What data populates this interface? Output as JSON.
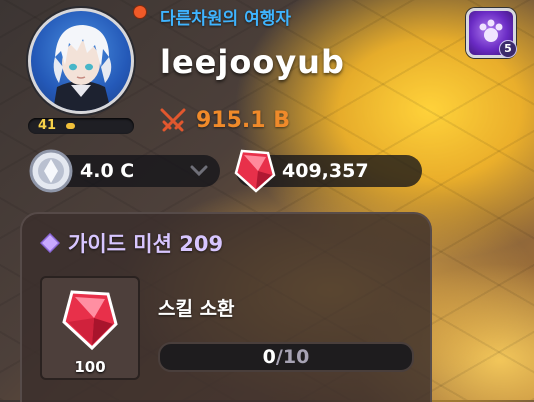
{
  "profile": {
    "subtitle": "다른차원의 여행자",
    "username": "leejooyub",
    "level": "41",
    "level_progress": 0.15,
    "combat_power": "915.1 B",
    "notification": true
  },
  "badge": {
    "count": "5",
    "icon": "purple-paw-emblem-icon"
  },
  "currencies": {
    "coin": {
      "value": "4.0 C",
      "icon": "silver-coin-icon"
    },
    "gem": {
      "value": "409,357",
      "icon": "red-gem-icon"
    }
  },
  "mission": {
    "title": "가이드 미션 209",
    "name": "스킬 소환",
    "reward_qty": "100",
    "reward_icon": "red-gem-icon",
    "progress_current": "0",
    "progress_separator": "/",
    "progress_max": "10",
    "progress_fraction": 0
  },
  "colors": {
    "subtitle": "#3fb4ff",
    "power": "#f08a2a",
    "mission_title": "#d8c6ff",
    "gem": "#e8304a"
  }
}
